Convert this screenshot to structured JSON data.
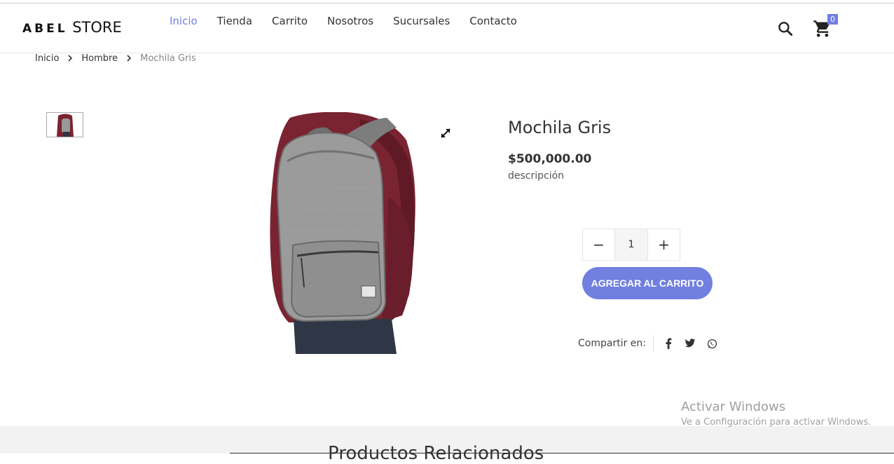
{
  "header": {
    "logo_main": "ABEL",
    "logo_sub": "STORE",
    "nav": [
      {
        "label": "Inicio",
        "active": true
      },
      {
        "label": "Tienda",
        "active": false
      },
      {
        "label": "Carrito",
        "active": false
      },
      {
        "label": "Nosotros",
        "active": false
      },
      {
        "label": "Sucursales",
        "active": false
      },
      {
        "label": "Contacto",
        "active": false
      }
    ],
    "search_icon": "search-icon",
    "cart_icon": "cart-icon",
    "cart_count": "0"
  },
  "breadcrumb": {
    "items": [
      "Inicio",
      "Hombre"
    ],
    "current": "Mochila Gris"
  },
  "product": {
    "title": "Mochila Gris",
    "price": "$500,000.00",
    "description": "descripción",
    "quantity": "1",
    "minus_label": "−",
    "plus_label": "+",
    "add_to_cart": "AGREGAR AL CARRITO",
    "share_label": "Compartir en:",
    "share_icons": [
      "facebook-icon",
      "twitter-icon",
      "whatsapp-icon"
    ]
  },
  "related": {
    "title": "Productos Relacionados"
  },
  "watermark": {
    "title": "Activar Windows",
    "subtitle": "Ve a Configuración para activar Windows."
  },
  "colors": {
    "accent": "#717fe0",
    "text": "#333333",
    "related_bg": "#f2f2f2"
  }
}
